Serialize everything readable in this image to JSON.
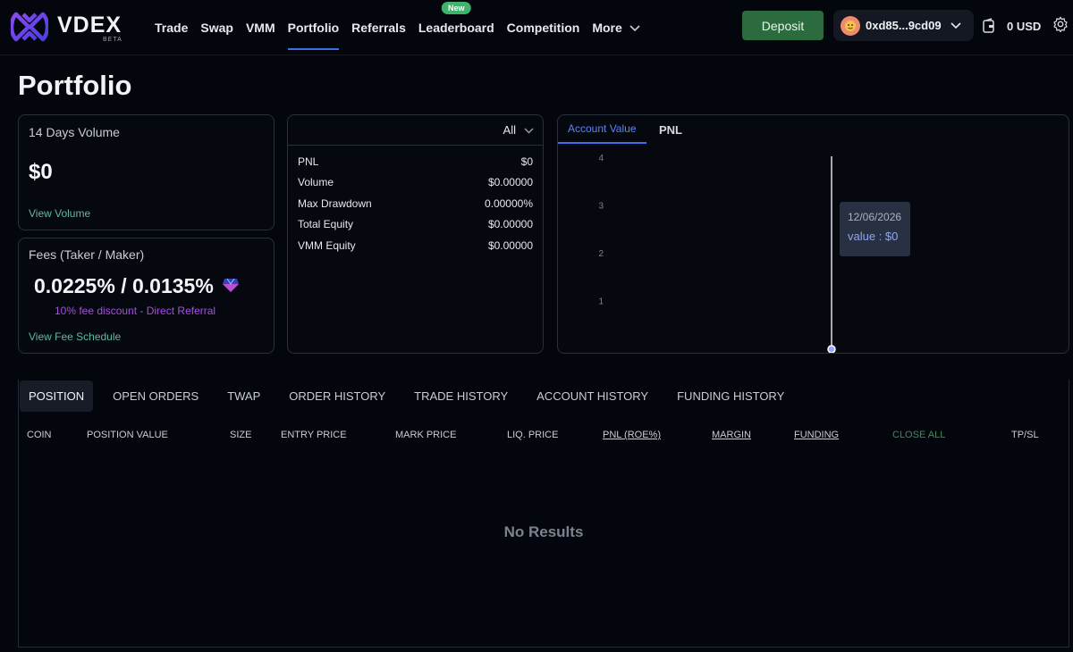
{
  "brand": {
    "name": "VDEX",
    "tag": "BETA"
  },
  "nav": {
    "items": [
      {
        "label": "Trade"
      },
      {
        "label": "Swap"
      },
      {
        "label": "VMM"
      },
      {
        "label": "Portfolio",
        "active": true
      },
      {
        "label": "Referrals"
      },
      {
        "label": "Leaderboard",
        "badge": "New"
      },
      {
        "label": "Competition"
      },
      {
        "label": "More"
      }
    ]
  },
  "header": {
    "deposit_label": "Deposit",
    "wallet_address": "0xd85...9cd09",
    "balance": "0 USD"
  },
  "page": {
    "title": "Portfolio"
  },
  "volume_card": {
    "label": "14 Days Volume",
    "value": "$0",
    "link": "View Volume"
  },
  "fees_card": {
    "label": "Fees (Taker / Maker)",
    "value": "0.0225% / 0.0135%",
    "discount": "10% fee discount - Direct Referral",
    "link": "View Fee Schedule"
  },
  "stats_card": {
    "range": "All",
    "rows": [
      {
        "label": "PNL",
        "value": "$0"
      },
      {
        "label": "Volume",
        "value": "$0.00000"
      },
      {
        "label": "Max Drawdown",
        "value": "0.00000%"
      },
      {
        "label": "Total Equity",
        "value": "$0.00000"
      },
      {
        "label": "VMM Equity",
        "value": "$0.00000"
      }
    ]
  },
  "chart_card": {
    "tabs": [
      {
        "label": "Account Value",
        "active": true
      },
      {
        "label": "PNL"
      }
    ],
    "tooltip": {
      "date": "12/06/2026",
      "value": "value : $0"
    }
  },
  "chart_data": {
    "type": "line",
    "title": "",
    "xlabel": "",
    "ylabel": "",
    "yticks": [
      1,
      2,
      3,
      4
    ],
    "ylim": [
      0,
      4
    ],
    "series": [
      {
        "values": [
          0
        ],
        "x": [
          "12/06/2026"
        ]
      }
    ],
    "colors": {
      "line": "#d9dce3",
      "tooltip_bg": "#283142",
      "accent": "#3d6ee8"
    }
  },
  "positions": {
    "tabs": [
      {
        "label": "POSITION",
        "active": true
      },
      {
        "label": "OPEN ORDERS"
      },
      {
        "label": "TWAP"
      },
      {
        "label": "ORDER HISTORY"
      },
      {
        "label": "TRADE HISTORY"
      },
      {
        "label": "ACCOUNT HISTORY"
      },
      {
        "label": "FUNDING HISTORY"
      }
    ],
    "columns": [
      "COIN",
      "POSITION VALUE",
      "SIZE",
      "ENTRY PRICE",
      "MARK PRICE",
      "LIQ. PRICE",
      "PNL (ROE%)",
      "MARGIN",
      "FUNDING",
      "CLOSE ALL",
      "TP/SL"
    ],
    "empty_text": "No Results"
  },
  "colors": {
    "brand_purple": "#6a3fd6",
    "deposit": "#2b6b3d",
    "accent": "#3d6ee8",
    "teal_link": "#5fb7a9",
    "discount": "#a64ee0"
  },
  "icons": {
    "logo": "vdex-logo",
    "wallet_avatar": "avatar-icon",
    "balance": "wallet-icon",
    "settings": "gear-icon",
    "fee_gem": "gem-icon"
  }
}
